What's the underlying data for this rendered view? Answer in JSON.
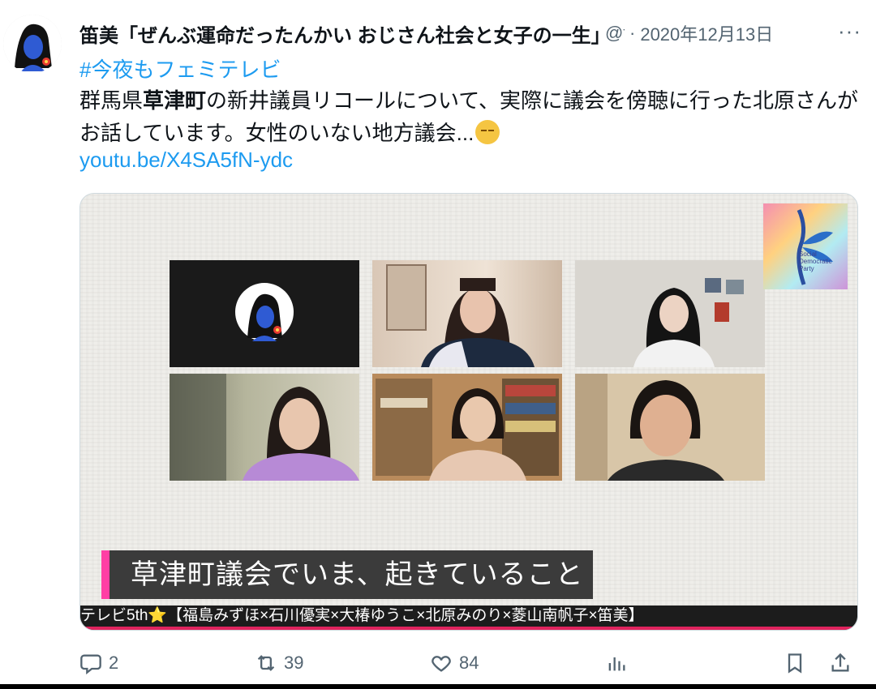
{
  "tweet": {
    "author_name": "笛美「ぜんぶ運命だったんかい おじさん社会と女子の一生」",
    "handle": "@fu",
    "separator": "·",
    "date": "2020年12月13日",
    "more_label": "···",
    "hashtag": "#今夜もフェミテレビ",
    "text_part1": "群馬県",
    "text_bold": "草津町",
    "text_part2": "の新井議員リコールについて、実際に議会を傍聴に行った北原さんがお話しています。女性のいない地方議会...",
    "emoji": "pensive-face-emoji",
    "link": "youtu.be/X4SA5fN-ydc"
  },
  "media": {
    "logo_text_line1": "Social",
    "logo_text_line2": "Democratic",
    "logo_text_line3": "Party",
    "caption": "草津町議会でいま、起きていること",
    "ticker": "テレビ5th⭐【福島みずほ×石川優実×大椿ゆうこ×北原みのり×菱山南帆子×笛美】",
    "tiles": [
      "avatar-tile",
      "participant-2",
      "participant-3",
      "participant-4",
      "participant-5",
      "participant-6"
    ]
  },
  "actions": {
    "reply_count": "2",
    "retweet_count": "39",
    "like_count": "84",
    "views_label": "",
    "icons": [
      "reply-icon",
      "retweet-icon",
      "like-icon",
      "views-icon",
      "bookmark-icon",
      "share-icon"
    ]
  },
  "colors": {
    "link": "#1d9bf0",
    "secondary": "#536471",
    "caption_accent": "#ff3fa4",
    "avatar_face": "#2f5bd3"
  }
}
